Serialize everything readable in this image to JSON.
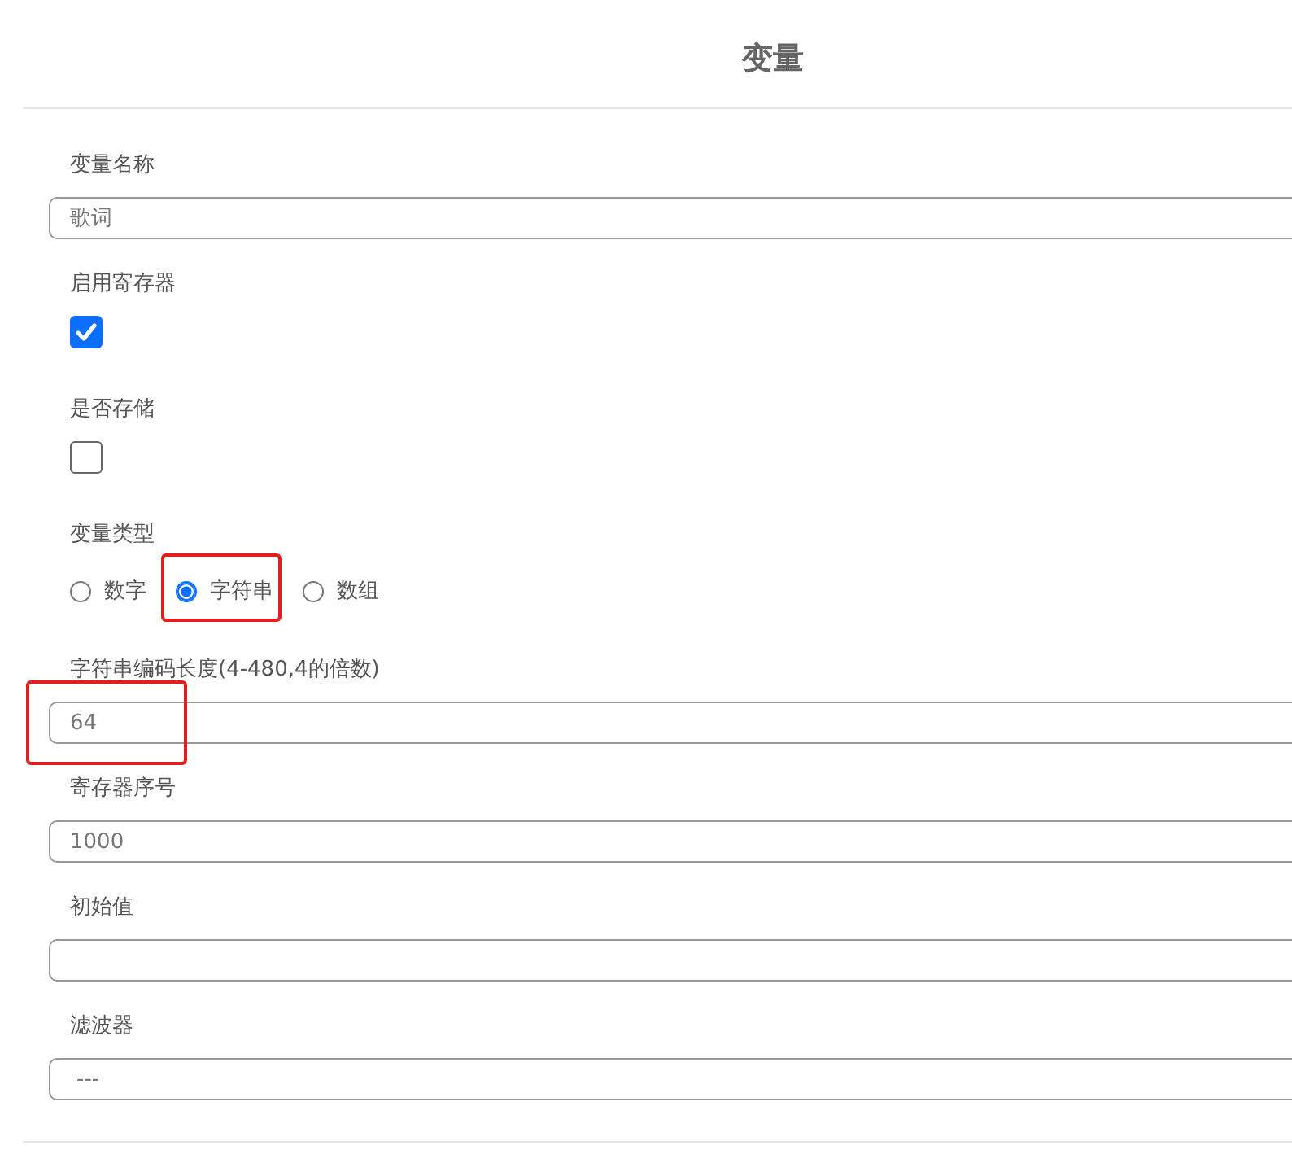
{
  "dialog": {
    "title": "变量"
  },
  "fields": [
    {
      "kind": "text",
      "label": "变量名称",
      "value": "歌词",
      "highlighted": false
    },
    {
      "kind": "checkbox",
      "label": "启用寄存器",
      "checked": true
    },
    {
      "kind": "checkbox",
      "label": "是否存储",
      "checked": false
    },
    {
      "kind": "radio",
      "label": "变量类型",
      "options": [
        {
          "label": "数字",
          "selected": false,
          "highlighted": false
        },
        {
          "label": "字符串",
          "selected": true,
          "highlighted": true
        },
        {
          "label": "数组",
          "selected": false,
          "highlighted": false
        }
      ]
    },
    {
      "kind": "text",
      "label": "字符串编码长度(4-480,4的倍数)",
      "value": "64",
      "highlighted": true
    },
    {
      "kind": "text",
      "label": "寄存器序号",
      "value": "1000",
      "highlighted": false
    },
    {
      "kind": "text",
      "label": "初始值",
      "highlighted": false
    },
    {
      "kind": "select",
      "label": "滤波器",
      "value": "---"
    }
  ]
}
